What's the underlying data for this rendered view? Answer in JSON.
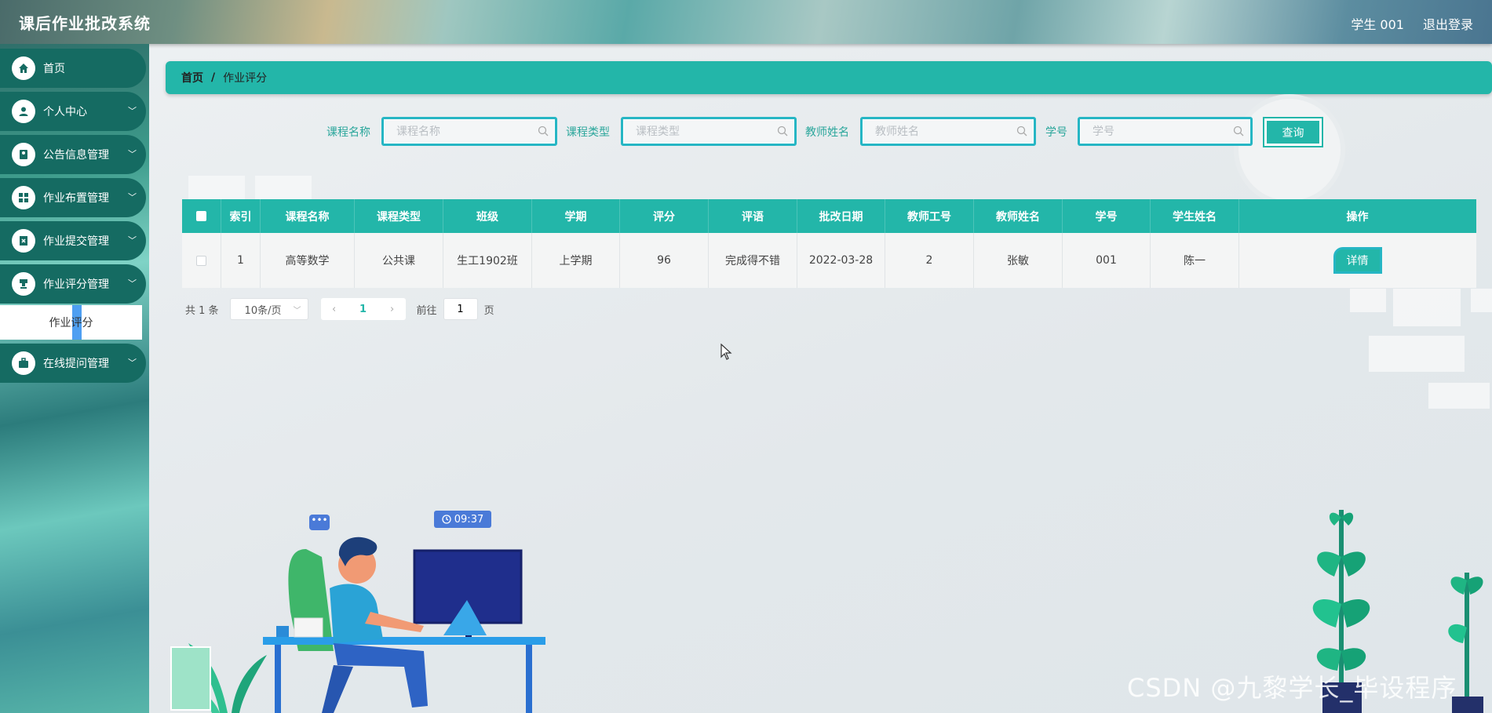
{
  "app": {
    "title": "课后作业批改系统"
  },
  "header": {
    "user": "学生 001",
    "logout": "退出登录"
  },
  "sidebar": {
    "items": [
      {
        "label": "首页",
        "icon": "home-icon",
        "has_children": false
      },
      {
        "label": "个人中心",
        "icon": "user-icon",
        "has_children": true
      },
      {
        "label": "公告信息管理",
        "icon": "announcement-icon",
        "has_children": true
      },
      {
        "label": "作业布置管理",
        "icon": "grid-icon",
        "has_children": true
      },
      {
        "label": "作业提交管理",
        "icon": "document-icon",
        "has_children": true
      },
      {
        "label": "作业评分管理",
        "icon": "stamp-icon",
        "has_children": true
      },
      {
        "label": "在线提问管理",
        "icon": "briefcase-icon",
        "has_children": true
      }
    ],
    "submenu_active": "作业评分"
  },
  "breadcrumb": {
    "home": "首页",
    "sep": "/",
    "current": "作业评分"
  },
  "search": {
    "fields": [
      {
        "label": "课程名称",
        "placeholder": "课程名称"
      },
      {
        "label": "课程类型",
        "placeholder": "课程类型"
      },
      {
        "label": "教师姓名",
        "placeholder": "教师姓名"
      },
      {
        "label": "学号",
        "placeholder": "学号"
      }
    ],
    "query_button": "查询"
  },
  "table": {
    "columns": [
      "索引",
      "课程名称",
      "课程类型",
      "班级",
      "学期",
      "评分",
      "评语",
      "批改日期",
      "教师工号",
      "教师姓名",
      "学号",
      "学生姓名",
      "操作"
    ],
    "rows": [
      {
        "index": "1",
        "course": "高等数学",
        "type": "公共课",
        "class": "生工1902班",
        "term": "上学期",
        "score": "96",
        "comment": "完成得不错",
        "date": "2022-03-28",
        "teacher_id": "2",
        "teacher_name": "张敏",
        "student_id": "001",
        "student_name": "陈一",
        "action": "详情"
      }
    ]
  },
  "pager": {
    "total": "共 1 条",
    "page_size": "10条/页",
    "current_page": "1",
    "goto_label": "前往",
    "goto_value": "1",
    "page_unit": "页"
  },
  "illustration": {
    "clock": "09:37",
    "bubble": "•••"
  },
  "watermark": "CSDN @九黎学长_毕设程序",
  "colors": {
    "accent": "#23b6a9",
    "sidebar_item": "#156b62",
    "input_border": "#26b6c4"
  }
}
